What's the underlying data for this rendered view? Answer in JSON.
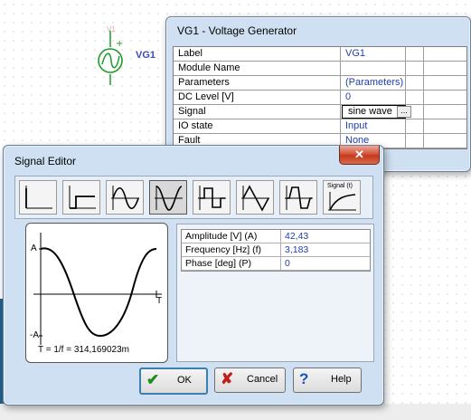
{
  "schematic": {
    "component_label": "VG1",
    "component_ghost_label": "V1"
  },
  "vg_window": {
    "title": "VG1 - Voltage Generator",
    "close_glyph": "✕",
    "properties": [
      {
        "key": "Label",
        "value": "VG1"
      },
      {
        "key": "Module Name",
        "value": ""
      },
      {
        "key": "Parameters",
        "value": "(Parameters)"
      },
      {
        "key": "DC Level [V]",
        "value": "0"
      },
      {
        "key": "Signal",
        "value": "sine wave"
      },
      {
        "key": "IO state",
        "value": "Input"
      },
      {
        "key": "Fault",
        "value": "None"
      }
    ],
    "ellipsis": "..."
  },
  "signal_editor": {
    "title": "Signal Editor",
    "close_glyph": "✕",
    "tools": [
      {
        "name": "tool-unit-step-icon"
      },
      {
        "name": "tool-pulse-step-icon"
      },
      {
        "name": "tool-sine-icon"
      },
      {
        "name": "tool-cosine-icon"
      },
      {
        "name": "tool-square-pulse-icon"
      },
      {
        "name": "tool-triangle-icon"
      },
      {
        "name": "tool-trapezoid-icon"
      },
      {
        "name": "tool-custom-signal-icon",
        "label": "Signal (t)"
      }
    ],
    "preview": {
      "top_label": "A",
      "bottom_label": "-A",
      "t_label": "T",
      "period_text": "T = 1/f = 314,169023m"
    },
    "params": [
      {
        "key": "Amplitude [V] (A)",
        "value": "42,43"
      },
      {
        "key": "Frequency [Hz] (f)",
        "value": "3,183"
      },
      {
        "key": "Phase [deg] (P)",
        "value": "0"
      }
    ],
    "buttons": {
      "ok": "OK",
      "cancel": "Cancel",
      "help": "Help"
    }
  },
  "colors": {
    "accent_value": "#1f3fa8",
    "window_frame": "#cfe0f2",
    "close_red": "#c43a1c",
    "component_green": "#1d9c2a"
  }
}
